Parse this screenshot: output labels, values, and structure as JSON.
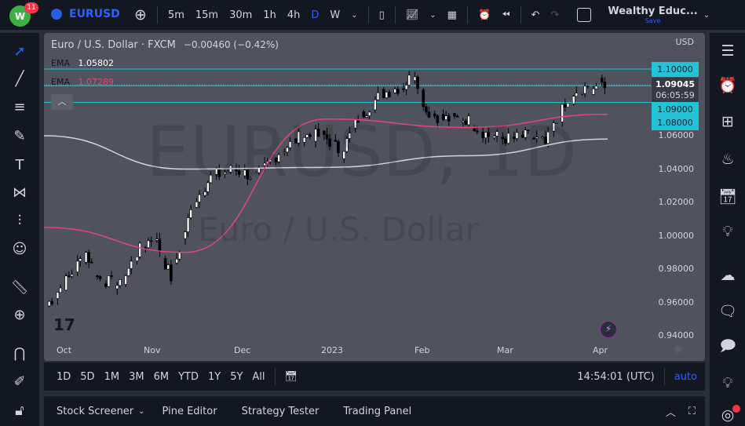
{
  "topbar": {
    "badge": "11",
    "logo": "W",
    "symbol": "EURUSD",
    "intervals": [
      "5m",
      "15m",
      "30m",
      "1h",
      "4h",
      "D",
      "W"
    ],
    "active_interval": "D",
    "layout_name": "Wealthy Educ...",
    "save_label": "Save"
  },
  "legend": {
    "title": "Euro / U.S. Dollar · FXCM",
    "change": "−0.00460 (−0.42%)",
    "ema1_label": "EMA",
    "ema1_value": "1.05802",
    "ema2_label": "EMA",
    "ema2_value": "1.07289"
  },
  "watermark": {
    "line1": "EURUSD, 1D",
    "line2": "Euro / U.S. Dollar"
  },
  "price_axis": {
    "currency": "USD",
    "ticks": [
      "1.06000",
      "1.04000",
      "1.02000",
      "1.00000",
      "0.98000",
      "0.96000",
      "0.94000"
    ],
    "alert_labels": [
      "1.10000",
      "1.09000",
      "1.08000"
    ],
    "last_price": "1.09045",
    "countdown": "06:05:59"
  },
  "time_axis": {
    "labels": [
      "Oct",
      "Nov",
      "Dec",
      "2023",
      "Feb",
      "Mar",
      "Apr"
    ]
  },
  "range_bar": {
    "ranges": [
      "1D",
      "5D",
      "1M",
      "3M",
      "6M",
      "YTD",
      "1Y",
      "5Y",
      "All"
    ],
    "time": "14:54:01 (UTC)",
    "auto": "auto"
  },
  "bottom_panel": {
    "tabs": [
      "Stock Screener",
      "Pine Editor",
      "Strategy Tester",
      "Trading Panel"
    ]
  },
  "colors": {
    "accent": "#2962ff",
    "cyan": "#22c3d6",
    "ema_fast": "#e0457b",
    "ema_slow": "#d1d4dc"
  },
  "chart_data": {
    "type": "candlestick",
    "ylim": [
      0.94,
      1.1
    ],
    "anchors": [
      [
        0,
        0.958
      ],
      [
        8,
        0.975
      ],
      [
        14,
        0.99
      ],
      [
        18,
        0.975
      ],
      [
        26,
        0.97
      ],
      [
        32,
        0.99
      ],
      [
        38,
        1.0
      ],
      [
        44,
        0.975
      ],
      [
        52,
        1.02
      ],
      [
        58,
        1.035
      ],
      [
        66,
        1.04
      ],
      [
        74,
        1.035
      ],
      [
        82,
        1.05
      ],
      [
        90,
        1.06
      ],
      [
        98,
        1.06
      ],
      [
        104,
        1.05
      ],
      [
        110,
        1.07
      ],
      [
        118,
        1.085
      ],
      [
        126,
        1.09
      ],
      [
        130,
        1.098
      ],
      [
        134,
        1.075
      ],
      [
        140,
        1.07
      ],
      [
        148,
        1.07
      ],
      [
        156,
        1.06
      ],
      [
        164,
        1.058
      ],
      [
        170,
        1.06
      ],
      [
        176,
        1.055
      ],
      [
        182,
        1.075
      ],
      [
        188,
        1.085
      ],
      [
        194,
        1.09
      ],
      [
        198,
        1.092
      ]
    ],
    "ema_slow": [
      1.06,
      1.04,
      1.041,
      1.048,
      1.058
    ],
    "ema_fast": [
      1.005,
      0.99,
      1.07,
      1.065,
      1.0729
    ],
    "hlines": [
      1.1,
      1.09,
      1.08
    ]
  }
}
